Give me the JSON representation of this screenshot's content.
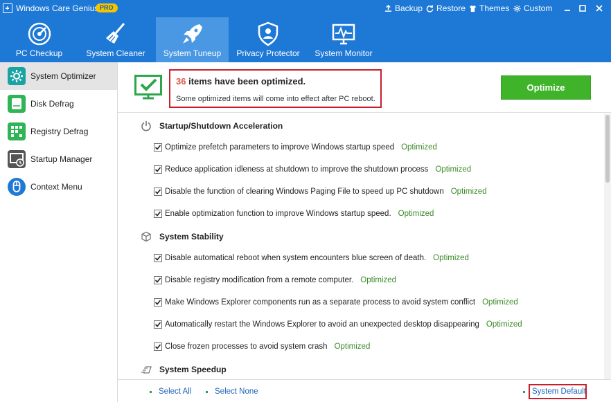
{
  "window": {
    "title": "Windows Care Genius",
    "badge": "PRO",
    "actions": [
      {
        "icon": "backup-icon",
        "label": "Backup"
      },
      {
        "icon": "restore-icon",
        "label": "Restore"
      },
      {
        "icon": "themes-icon",
        "label": "Themes"
      },
      {
        "icon": "custom-icon",
        "label": "Custom"
      }
    ]
  },
  "nav": {
    "tabs": [
      {
        "icon": "pc-checkup-icon",
        "label": "PC Checkup"
      },
      {
        "icon": "broom-icon",
        "label": "System Cleaner"
      },
      {
        "icon": "rocket-icon",
        "label": "System Tuneup",
        "active": true
      },
      {
        "icon": "shield-icon",
        "label": "Privacy Protector"
      },
      {
        "icon": "monitor-icon",
        "label": "System Monitor"
      }
    ]
  },
  "sidebar": {
    "items": [
      {
        "icon": "gear-icon",
        "label": "System Optimizer",
        "color": "#1aa3a3",
        "active": true
      },
      {
        "icon": "disk-icon",
        "label": "Disk Defrag",
        "color": "#2fb457"
      },
      {
        "icon": "registry-icon",
        "label": "Registry Defrag",
        "color": "#2fb457"
      },
      {
        "icon": "startup-icon",
        "label": "Startup Manager",
        "color": "#555555"
      },
      {
        "icon": "mouse-icon",
        "label": "Context Menu",
        "color": "#1e78d6"
      }
    ]
  },
  "header": {
    "count": "36",
    "title_suffix": " items have been optimized.",
    "subtitle": "Some optimized items will come into effect after PC reboot.",
    "optimize_label": "Optimize"
  },
  "sections": [
    {
      "title": "Startup/Shutdown Acceleration",
      "icon": "power-icon",
      "items": [
        {
          "label": "Optimize prefetch parameters to improve Windows startup speed",
          "status": "Optimized",
          "checked": true
        },
        {
          "label": "Reduce application idleness at shutdown to improve the shutdown process",
          "status": "Optimized",
          "checked": true
        },
        {
          "label": "Disable the function of clearing Windows Paging File to speed up PC shutdown",
          "status": "Optimized",
          "checked": true
        },
        {
          "label": "Enable optimization function to improve Windows startup speed.",
          "status": "Optimized",
          "checked": true
        }
      ]
    },
    {
      "title": "System Stability",
      "icon": "cube-icon",
      "items": [
        {
          "label": "Disable automatical reboot when system encounters blue screen of death.",
          "status": "Optimized",
          "checked": true
        },
        {
          "label": "Disable registry modification from a remote computer.",
          "status": "Optimized",
          "checked": true
        },
        {
          "label": "Make Windows Explorer components run as a separate process to avoid system conflict",
          "status": "Optimized",
          "checked": true
        },
        {
          "label": "Automatically restart the Windows Explorer to avoid an unexpected desktop disappearing",
          "status": "Optimized",
          "checked": true
        },
        {
          "label": "Close frozen processes to avoid system crash",
          "status": "Optimized",
          "checked": true
        }
      ]
    },
    {
      "title": "System Speedup",
      "icon": "speed-icon",
      "items": []
    }
  ],
  "footer": {
    "select_all": "Select All",
    "select_none": "Select None",
    "system_default": "System Default"
  }
}
